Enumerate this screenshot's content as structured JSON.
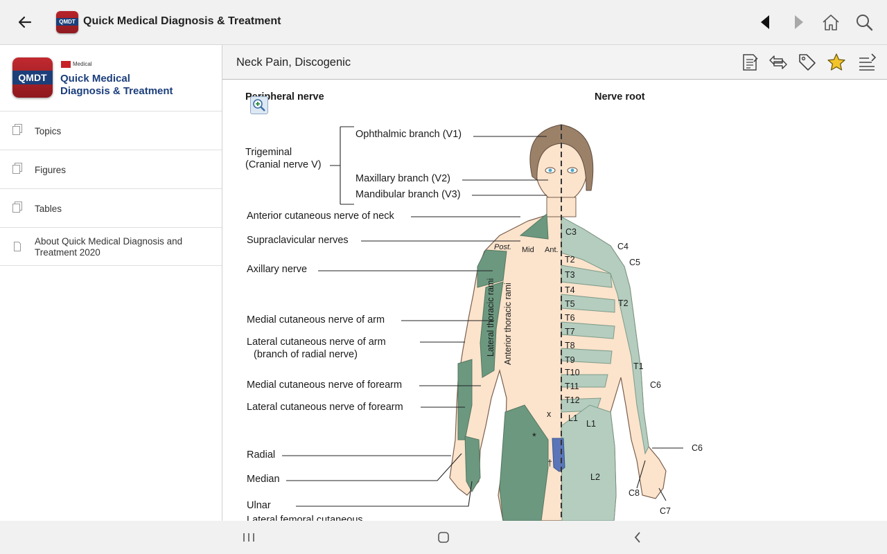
{
  "app": {
    "title": "Quick Medical Diagnosis & Treatment",
    "icon_text": "QMDT"
  },
  "toolbar": {
    "icons": [
      "arrow-left-icon",
      "triangle-left-icon",
      "triangle-right-icon",
      "home-icon",
      "search-icon"
    ]
  },
  "sidebar": {
    "logo_text": "QMDT",
    "publisher": "Medical",
    "brand_line1": "Quick Medical",
    "brand_line2": "Diagnosis & Treatment",
    "items": [
      {
        "label": "Topics",
        "icon": "documents-icon"
      },
      {
        "label": "Figures",
        "icon": "documents-icon"
      },
      {
        "label": "Tables",
        "icon": "documents-icon"
      },
      {
        "label": "About Quick Medical Diagnosis and Treatment 2020",
        "icon": "document-icon"
      }
    ]
  },
  "content": {
    "topic_title": "Neck Pain, Discogenic",
    "actions": [
      "notes-icon",
      "swap-arrows-icon",
      "tag-icon",
      "star-icon",
      "sort-lines-icon"
    ]
  },
  "figure": {
    "heading_left": "Peripheral nerve",
    "heading_right": "Nerve root",
    "labels": {
      "ophthalmic": "Ophthalmic branch (V1)",
      "trigeminal1": "Trigeminal",
      "trigeminal2": "(Cranial nerve V)",
      "maxillary": "Maxillary branch (V2)",
      "mandibular": "Mandibular branch (V3)",
      "ant_cut_neck": "Anterior cutaneous nerve of neck",
      "supraclav": "Supraclavicular nerves",
      "axillary": "Axillary nerve",
      "med_cut_arm": "Medial cutaneous nerve of arm",
      "lat_cut_arm1": "Lateral cutaneous nerve of arm",
      "lat_cut_arm2": "(branch of radial nerve)",
      "med_cut_forearm": "Medial cutaneous nerve of forearm",
      "lat_cut_forearm": "Lateral cutaneous nerve of forearm",
      "radial": "Radial",
      "median": "Median",
      "ulnar": "Ulnar",
      "lat_fem": "Lateral femoral cutaneous",
      "post": "Post.",
      "mid": "Mid",
      "ant": "Ant.",
      "lat_thoracic": "Lateral thoracic rami",
      "ant_thoracic": "Anterior thoracic rami",
      "x_mark": "x",
      "star_mark": "*",
      "dagger_mark": "†"
    },
    "dermatomes": {
      "c3": "C3",
      "c4": "C4",
      "c5": "C5",
      "t2": "T2",
      "t3": "T3",
      "t4": "T4",
      "t5": "T5",
      "t2b": "T2",
      "t6": "T6",
      "t7": "T7",
      "t8": "T8",
      "t9": "T9",
      "t10": "T10",
      "t11": "T11",
      "t12": "T12",
      "t1": "T1",
      "c6a": "C6",
      "l1a": "L1",
      "l1b": "L1",
      "l2": "L2",
      "c6b": "C6",
      "c8": "C8",
      "c7": "C7"
    },
    "colors": {
      "skin": "#fbe3cc",
      "dark_green": "#6c9880",
      "light_green": "#b4cdbf",
      "hair": "#9c8169",
      "blue": "#5a75b8"
    }
  },
  "navbar": {
    "icons": [
      "recent-apps-icon",
      "home-circle-icon",
      "back-chevron-icon"
    ]
  }
}
